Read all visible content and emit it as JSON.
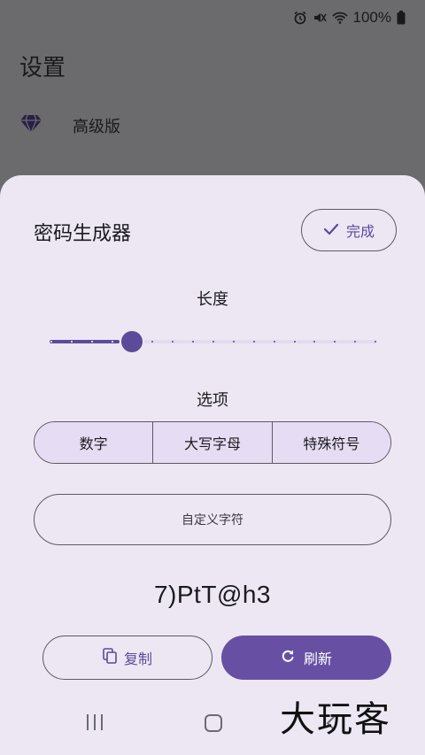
{
  "status_bar": {
    "battery_text": "100%",
    "icons": [
      "alarm-icon",
      "mute-icon",
      "wifi-icon",
      "battery-icon"
    ]
  },
  "background": {
    "title": "设置",
    "premium_label": "高级版",
    "premium_icon": "diamond-icon"
  },
  "sheet": {
    "title": "密码生成器",
    "done_label": "完成",
    "length_label": "长度",
    "options_label": "选项",
    "options": [
      {
        "label": "数字",
        "selected": true
      },
      {
        "label": "大写字母",
        "selected": true
      },
      {
        "label": "特殊符号",
        "selected": true
      }
    ],
    "custom_chars_label": "自定义字符",
    "password": "7)PtT@h3",
    "copy_label": "复制",
    "refresh_label": "刷新",
    "slider": {
      "position_fraction": 0.25,
      "tick_count": 17
    }
  },
  "navbar": {
    "icons": [
      "recent-apps-icon",
      "home-icon",
      "back-icon"
    ]
  },
  "watermark": "大玩客",
  "colors": {
    "accent": "#6750a4",
    "accent_text": "#5c4a9a",
    "sheet_bg": "#ede7f4",
    "scrim": "#6b6b6e"
  }
}
